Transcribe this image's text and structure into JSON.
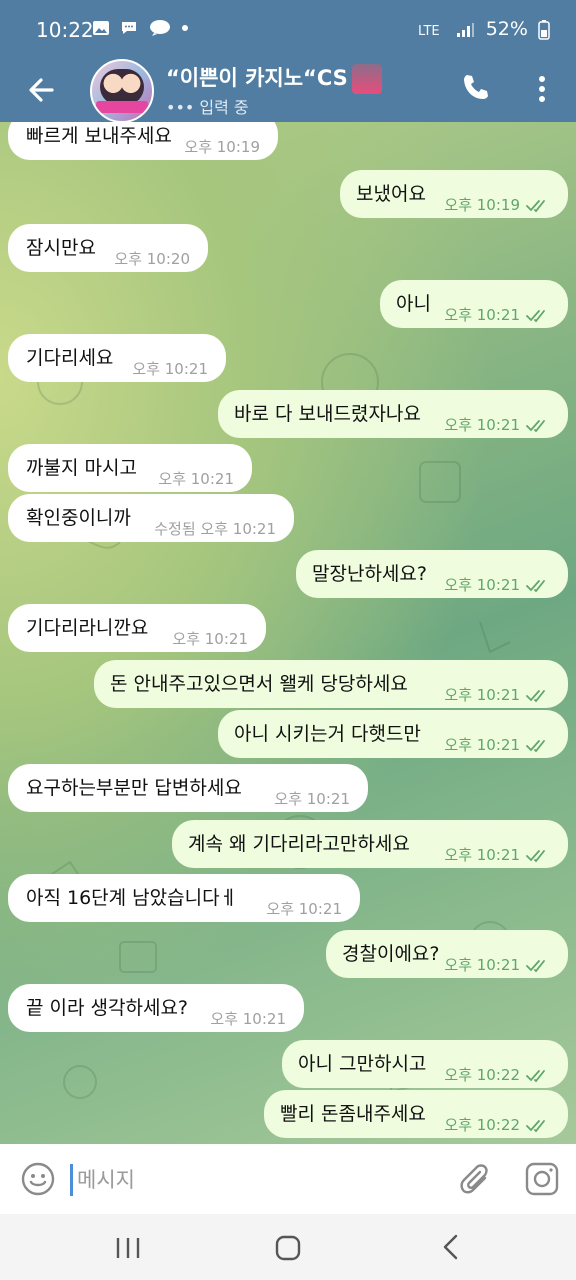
{
  "status_bar": {
    "time": "10:22",
    "notification_icons": [
      "image-icon",
      "chat-icon",
      "talk-icon",
      "dot-icon"
    ],
    "network_label": "LTE",
    "battery": "52%"
  },
  "header": {
    "title": "“이쁜이 카지노“CS",
    "subtitle": "••• 입력 중"
  },
  "messages": [
    {
      "dir": "in",
      "text": "빠르게 보내주세요",
      "time": "오후 10:19"
    },
    {
      "dir": "out",
      "text": "보냈어요",
      "time": "오후 10:19"
    },
    {
      "dir": "in",
      "text": "잠시만요",
      "time": "오후 10:20"
    },
    {
      "dir": "out",
      "text": "아니",
      "time": "오후 10:21"
    },
    {
      "dir": "in",
      "text": "기다리세요",
      "time": "오후 10:21"
    },
    {
      "dir": "out",
      "text": "바로 다 보내드렸자나요",
      "time": "오후 10:21"
    },
    {
      "dir": "in",
      "text": "까불지 마시고",
      "time": "오후 10:21"
    },
    {
      "dir": "in",
      "text": "확인중이니까",
      "time": "수정됨 오후 10:21"
    },
    {
      "dir": "out",
      "text": "말장난하세요?",
      "time": "오후 10:21"
    },
    {
      "dir": "in",
      "text": "기다리라니깐요",
      "time": "오후 10:21"
    },
    {
      "dir": "out",
      "text": "돈 안내주고있으면서 왤케 당당하세요",
      "time": "오후 10:21"
    },
    {
      "dir": "out",
      "text": "아니 시키는거 다햇드만",
      "time": "오후 10:21"
    },
    {
      "dir": "in",
      "text": "요구하는부분만 답변하세요",
      "time": "오후 10:21"
    },
    {
      "dir": "out",
      "text": "계속 왜 기다리라고만하세요",
      "time": "오후 10:21"
    },
    {
      "dir": "in",
      "text": "아직 16단계 남았습니다ㅔ",
      "time": "오후 10:21"
    },
    {
      "dir": "out",
      "text": "경찰이에요?",
      "time": "오후 10:21"
    },
    {
      "dir": "in",
      "text": "끝 이라 생각하세요?",
      "time": "오후 10:21"
    },
    {
      "dir": "out",
      "text": "아니 그만하시고",
      "time": "오후 10:22"
    },
    {
      "dir": "out",
      "text": "빨리 돈좀내주세요",
      "time": "오후 10:22"
    }
  ],
  "input": {
    "placeholder": "메시지"
  },
  "colors": {
    "header": "#517da2",
    "bubble_in": "#ffffff",
    "bubble_out": "#effdde",
    "check": "#5fa56c"
  },
  "icons": {
    "header": [
      "back-arrow-icon",
      "phone-icon",
      "more-vertical-icon"
    ],
    "input": [
      "emoji-icon",
      "attach-icon",
      "camera-icon"
    ],
    "nav": [
      "recent-apps-icon",
      "home-icon",
      "back-icon"
    ]
  }
}
